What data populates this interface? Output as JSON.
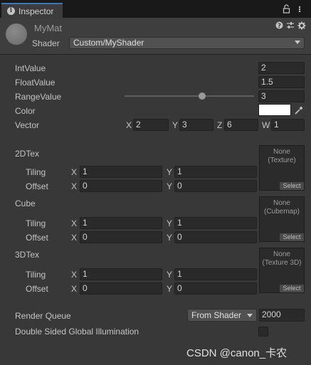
{
  "tab": {
    "title": "Inspector"
  },
  "material": {
    "name": "MyMat",
    "shader_label": "Shader",
    "shader_value": "Custom/MyShader"
  },
  "properties": {
    "int_value": {
      "label": "IntValue",
      "value": "2"
    },
    "float_value": {
      "label": "FloatValue",
      "value": "1.5"
    },
    "range_value": {
      "label": "RangeValue",
      "value": "3",
      "fraction": 0.6
    },
    "color": {
      "label": "Color",
      "swatch": "#ffffff"
    },
    "vector": {
      "label": "Vector",
      "components": [
        {
          "axis": "X",
          "value": "2"
        },
        {
          "axis": "Y",
          "value": "3"
        },
        {
          "axis": "Z",
          "value": "6"
        },
        {
          "axis": "W",
          "value": "1"
        }
      ]
    }
  },
  "textures": [
    {
      "label": "2DTex",
      "slot_line1": "None",
      "slot_line2": "(Texture)",
      "select": "Select",
      "tiling_label": "Tiling",
      "offset_label": "Offset",
      "tiling": {
        "x_axis": "X",
        "x": "1",
        "y_axis": "Y",
        "y": "1"
      },
      "offset": {
        "x_axis": "X",
        "x": "0",
        "y_axis": "Y",
        "y": "0"
      }
    },
    {
      "label": "Cube",
      "slot_line1": "None",
      "slot_line2": "(Cubemap)",
      "select": "Select",
      "tiling_label": "Tiling",
      "offset_label": "Offset",
      "tiling": {
        "x_axis": "X",
        "x": "1",
        "y_axis": "Y",
        "y": "1"
      },
      "offset": {
        "x_axis": "X",
        "x": "0",
        "y_axis": "Y",
        "y": "0"
      }
    },
    {
      "label": "3DTex",
      "slot_line1": "None",
      "slot_line2": "(Texture 3D)",
      "select": "Select",
      "tiling_label": "Tiling",
      "offset_label": "Offset",
      "tiling": {
        "x_axis": "X",
        "x": "1",
        "y_axis": "Y",
        "y": "1"
      },
      "offset": {
        "x_axis": "X",
        "x": "0",
        "y_axis": "Y",
        "y": "0"
      }
    }
  ],
  "render_queue": {
    "label": "Render Queue",
    "mode": "From Shader",
    "value": "2000"
  },
  "double_sided_gi": {
    "label": "Double Sided Global Illumination",
    "checked": false
  },
  "watermark": "CSDN @canon_卡农",
  "colors": {
    "panel": "#383838",
    "field": "#2a2a2a",
    "tab_accent": "#3a79bb",
    "header": "#3e3e3e"
  },
  "icons": [
    "info-icon",
    "lock-icon",
    "menu-icon",
    "help-icon",
    "presets-icon",
    "settings-icon",
    "eyedropper-icon",
    "dropdown-arrow-icon"
  ]
}
